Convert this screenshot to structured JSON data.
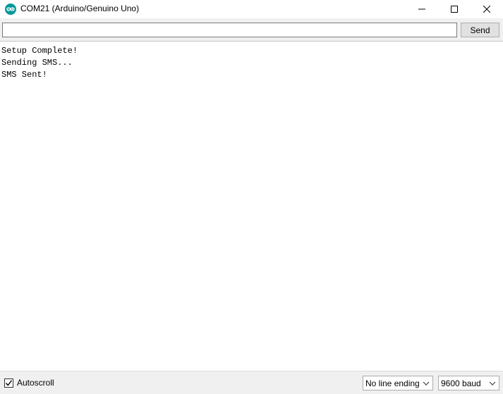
{
  "window": {
    "title": "COM21 (Arduino/Genuino Uno)",
    "icon": "arduino-logo-icon",
    "controls": [
      "minimize-icon",
      "maximize-icon",
      "close-icon"
    ],
    "accent": "#00979c"
  },
  "command": {
    "input_value": "",
    "send_label": "Send"
  },
  "output": {
    "lines": [
      "Setup Complete!",
      "Sending SMS...",
      "SMS Sent!"
    ]
  },
  "status": {
    "autoscroll_label": "Autoscroll",
    "autoscroll_checked": true,
    "line_ending": "No line ending",
    "baud": "9600 baud"
  }
}
